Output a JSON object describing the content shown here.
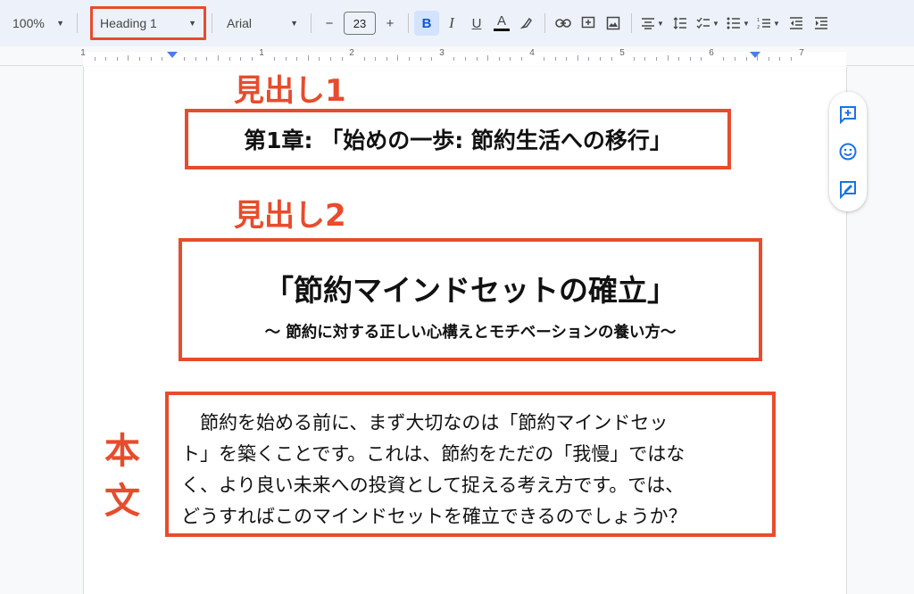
{
  "toolbar": {
    "zoom": "100%",
    "paragraph_style": "Heading 1",
    "font": "Arial",
    "font_size": "23",
    "decrease_font": "−",
    "increase_font": "+",
    "bold_glyph": "B",
    "italic_glyph": "I",
    "underline_glyph": "U",
    "text_color_glyph": "A",
    "text_color": "#111111",
    "icons": [
      "highlighter-icon",
      "link-icon",
      "comment-icon",
      "image-icon",
      "align-center-icon",
      "line-spacing-icon",
      "checklist-icon",
      "bulleted-list-icon",
      "numbered-list-icon",
      "decrease-indent-icon",
      "increase-indent-icon"
    ]
  },
  "ruler": {
    "numbers": [
      "1",
      "1",
      "2",
      "3",
      "4",
      "5",
      "6",
      "7"
    ]
  },
  "annotations": {
    "heading1_label": "見出し1",
    "heading2_label": "見出し2",
    "body_label_line1": "本",
    "body_label_line2": "文",
    "color": "#e74c2c"
  },
  "document": {
    "heading1": "第1章: 「始めの一歩: 節約生活への移行」",
    "heading2": "「節約マインドセットの確立」",
    "heading2_subtitle": "〜 節約に対する正しい心構えとモチベーションの養い方〜",
    "body_lines": [
      "　節約を始める前に、まず大切なのは「節約マインドセッ",
      "ト」を築くことです。これは、節約をただの「我慢」ではな",
      "く、より良い未来への投資として捉える考え方です。では、",
      "どうすればこのマインドセットを確立できるのでしょうか？"
    ]
  },
  "side_panel": {
    "icons": [
      "add-comment-icon",
      "emoji-reaction-icon",
      "suggest-edits-icon"
    ]
  }
}
